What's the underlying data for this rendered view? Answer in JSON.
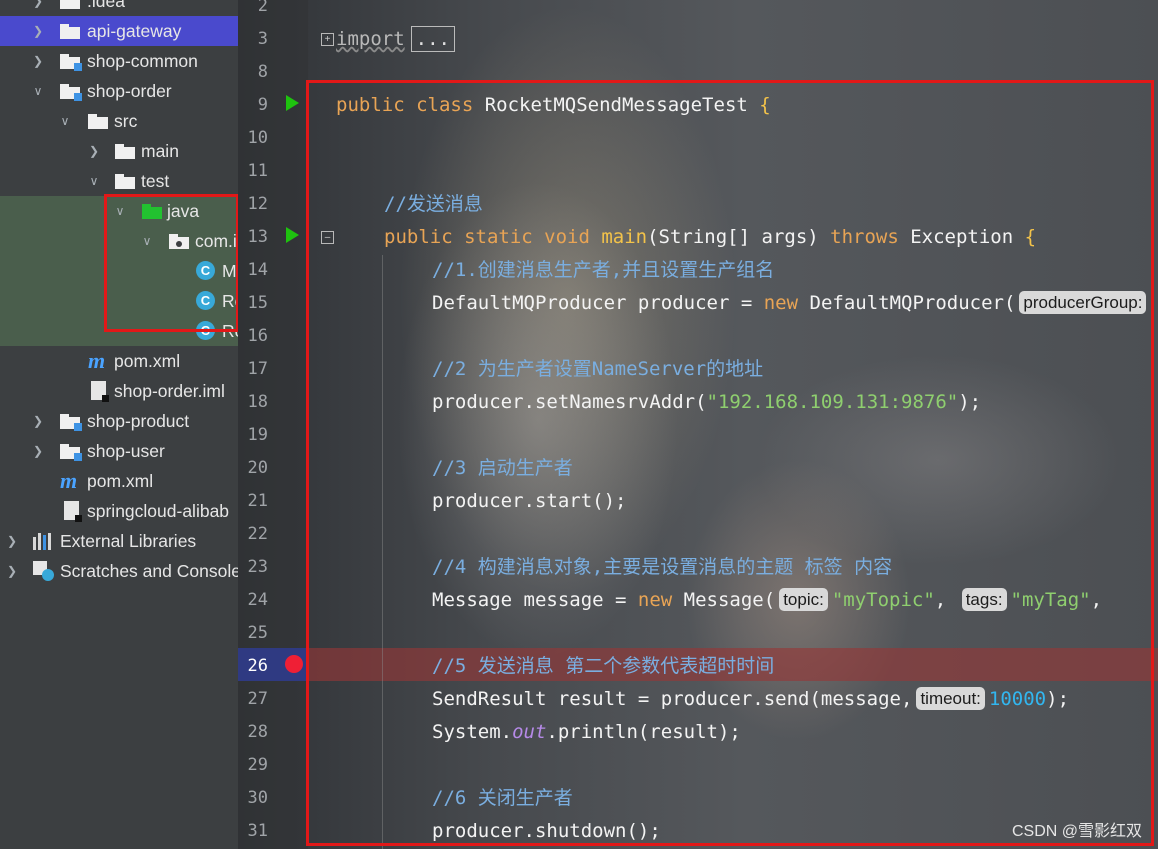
{
  "project_tree": {
    "items": [
      {
        "label": ".idea"
      },
      {
        "label": "api-gateway"
      },
      {
        "label": "shop-common"
      },
      {
        "label": "shop-order"
      },
      {
        "label": "src"
      },
      {
        "label": "main"
      },
      {
        "label": "test"
      },
      {
        "label": "java"
      },
      {
        "label": "com.i"
      },
      {
        "label": "M"
      },
      {
        "label": "Ro"
      },
      {
        "label": "Ro"
      },
      {
        "label": "pom.xml"
      },
      {
        "label": "shop-order.iml"
      },
      {
        "label": "shop-product"
      },
      {
        "label": "shop-user"
      },
      {
        "label": "pom.xml"
      },
      {
        "label": "springcloud-alibab"
      },
      {
        "label": "External Libraries"
      },
      {
        "label": "Scratches and Console"
      }
    ]
  },
  "editor": {
    "line_numbers": [
      "2",
      "3",
      "8",
      "9",
      "10",
      "11",
      "12",
      "13",
      "14",
      "15",
      "16",
      "17",
      "18",
      "19",
      "20",
      "21",
      "22",
      "23",
      "24",
      "25",
      "26",
      "27",
      "28",
      "29",
      "30",
      "31"
    ],
    "current_line": "26",
    "code": {
      "l3_kw": "import",
      "l3_fold": "...",
      "l9_kw": "public class",
      "l9_name": " RocketMQSendMessageTest ",
      "l9_brace": "{",
      "l12_cmt": "//发送消息",
      "l13_kw1": "public static void",
      "l13_fn": " main",
      "l13_rest": "(String[] args) ",
      "l13_kw2": "throws",
      "l13_rest2": " Exception ",
      "l13_brace": "{",
      "l14_cmt": "//1.创建消息生产者,并且设置生产组名",
      "l15_a": "DefaultMQProducer producer = ",
      "l15_kw": "new",
      "l15_b": " DefaultMQProducer(",
      "l15_hint": "producerGroup:",
      "l17_cmt": "//2 为生产者设置NameServer的地址",
      "l18_a": "producer.setNamesrvAddr(",
      "l18_str": "\"192.168.109.131:9876\"",
      "l18_b": ");",
      "l20_cmt": "//3 启动生产者",
      "l21_a": "producer.start();",
      "l23_cmt": "//4 构建消息对象,主要是设置消息的主题 标签 内容",
      "l24_a": "Message message = ",
      "l24_kw": "new",
      "l24_b": " Message(",
      "l24_hint1": "topic:",
      "l24_str1": "\"myTopic\"",
      "l24_c": ",",
      "l24_hint2": "tags:",
      "l24_str2": "\"myTag\"",
      "l24_d": ",",
      "l26_cmt": "//5 发送消息 第二个参数代表超时时间",
      "l27_a": "SendResult result = producer.send(message,",
      "l27_hint": "timeout:",
      "l27_num": "10000",
      "l27_b": ");",
      "l28_a": "System.",
      "l28_field": "out",
      "l28_b": ".println(result);",
      "l30_cmt": "//6 关闭生产者",
      "l31_a": "producer.shutdown();"
    }
  },
  "watermark": "CSDN @雪影红双",
  "colors": {
    "annotation_red": "#e21818",
    "selection": "#4a4acd",
    "breakpoint": "#ef1f35",
    "run_marker": "#1ec20f"
  }
}
